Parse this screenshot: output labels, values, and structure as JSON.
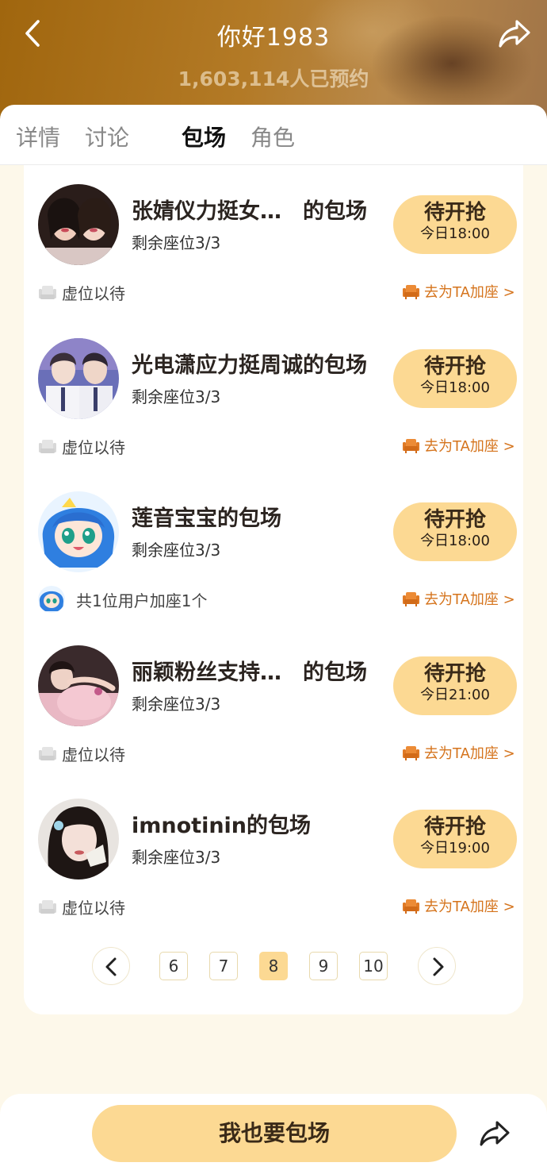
{
  "header": {
    "title": "你好1983",
    "subtitle": "1,603,114人已预约",
    "back_icon": "chevron-left-icon",
    "share_icon": "share-icon"
  },
  "tabs": [
    {
      "label": "详情",
      "active": false
    },
    {
      "label": "讨论",
      "active": false
    },
    {
      "label": "包场",
      "active": true
    },
    {
      "label": "角色",
      "active": false
    }
  ],
  "sessions": [
    {
      "name": "张婧仪力挺女…　的包场",
      "seats": "剩余座位3/3",
      "status": "待开抢",
      "time": "今日18:00",
      "footer": "虚位以待",
      "footer_type": "empty",
      "add_seat": "去为TA加座 >",
      "avatar": "two-women-photo"
    },
    {
      "name": "光电潇应力挺周诚的包场",
      "seats": "剩余座位3/3",
      "status": "待开抢",
      "time": "今日18:00",
      "footer": "虚位以待",
      "footer_type": "empty",
      "add_seat": "去为TA加座 >",
      "avatar": "two-men-photo"
    },
    {
      "name": "莲音宝宝的包场",
      "seats": "剩余座位3/3",
      "status": "待开抢",
      "time": "今日18:00",
      "footer": "共1位用户加座1个",
      "footer_type": "users",
      "add_seat": "去为TA加座 >",
      "avatar": "anime-girl-blue-hair"
    },
    {
      "name": "丽颖粉丝支持…　的包场",
      "seats": "剩余座位3/3",
      "status": "待开抢",
      "time": "今日21:00",
      "footer": "虚位以待",
      "footer_type": "empty",
      "add_seat": "去为TA加座 >",
      "avatar": "woman-pink-dress-photo"
    },
    {
      "name": "imnotinin的包场",
      "seats": "剩余座位3/3",
      "status": "待开抢",
      "time": "今日19:00",
      "footer": "虚位以待",
      "footer_type": "empty",
      "add_seat": "去为TA加座 >",
      "avatar": "woman-portrait-photo"
    }
  ],
  "pagination": {
    "pages": [
      "6",
      "7",
      "8",
      "9",
      "10"
    ],
    "current": "8",
    "prev_icon": "chevron-left-icon",
    "next_icon": "chevron-right-icon"
  },
  "bottom": {
    "cta_label": "我也要包场",
    "share_icon": "share-icon"
  },
  "colors": {
    "accent": "#fcd993",
    "orange_link": "#d5741d",
    "page_bg": "#fdf8ea"
  }
}
